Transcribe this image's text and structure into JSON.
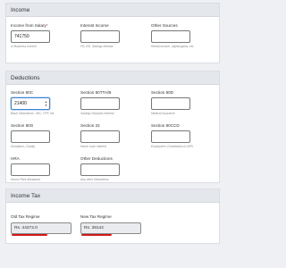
{
  "income": {
    "title": "Income",
    "salary": {
      "label": "Income from Salary",
      "required_mark": "*",
      "value": "741750",
      "hint": "or Business Income"
    },
    "interest": {
      "label": "Interest Income",
      "value": "",
      "hint": "FD, RD, Savings Interest"
    },
    "other": {
      "label": "Other Sources",
      "value": "",
      "hint": "Rental income, capital gains, etc."
    }
  },
  "deductions": {
    "title": "Deductions",
    "s80c": {
      "label": "Section 80C",
      "value": "21400",
      "hint": "Basic Deductions - 80C, PPF, etc.",
      "spin_up": "▲",
      "spin_down": "▼"
    },
    "s80tta": {
      "label": "Section 80TTA/B",
      "value": "",
      "hint": "Savings Deposits Interest"
    },
    "s80d": {
      "label": "Section 80D",
      "value": "",
      "hint": "Medical Insurance"
    },
    "s80g": {
      "label": "Section 80G",
      "value": "",
      "hint": "Donations, Charity"
    },
    "s24": {
      "label": "Section 24",
      "value": "",
      "hint": "Home Loan Interest"
    },
    "s80ccd": {
      "label": "Section 80CCD",
      "value": "",
      "hint": "Employee's Contribution to NPS"
    },
    "hra": {
      "label": "HRA",
      "value": "",
      "hint": "House Rent Allowance"
    },
    "other": {
      "label": "Other Deductions",
      "value": "",
      "hint": "Any other Deductions"
    }
  },
  "income_tax": {
    "title": "Income Tax",
    "old_regime": {
      "label": "Old Tax Regime",
      "value": "Rs. 44272.0"
    },
    "new_regime": {
      "label": "New Tax Regime",
      "value": "Rs. 38142"
    }
  },
  "colors": {
    "background": "#eef0f4",
    "section_header": "#e4e7ec",
    "focus_border": "#3b82d6",
    "required": "#c0392b",
    "underline": "#d21a1a",
    "result_bg": "#e9ebee"
  }
}
